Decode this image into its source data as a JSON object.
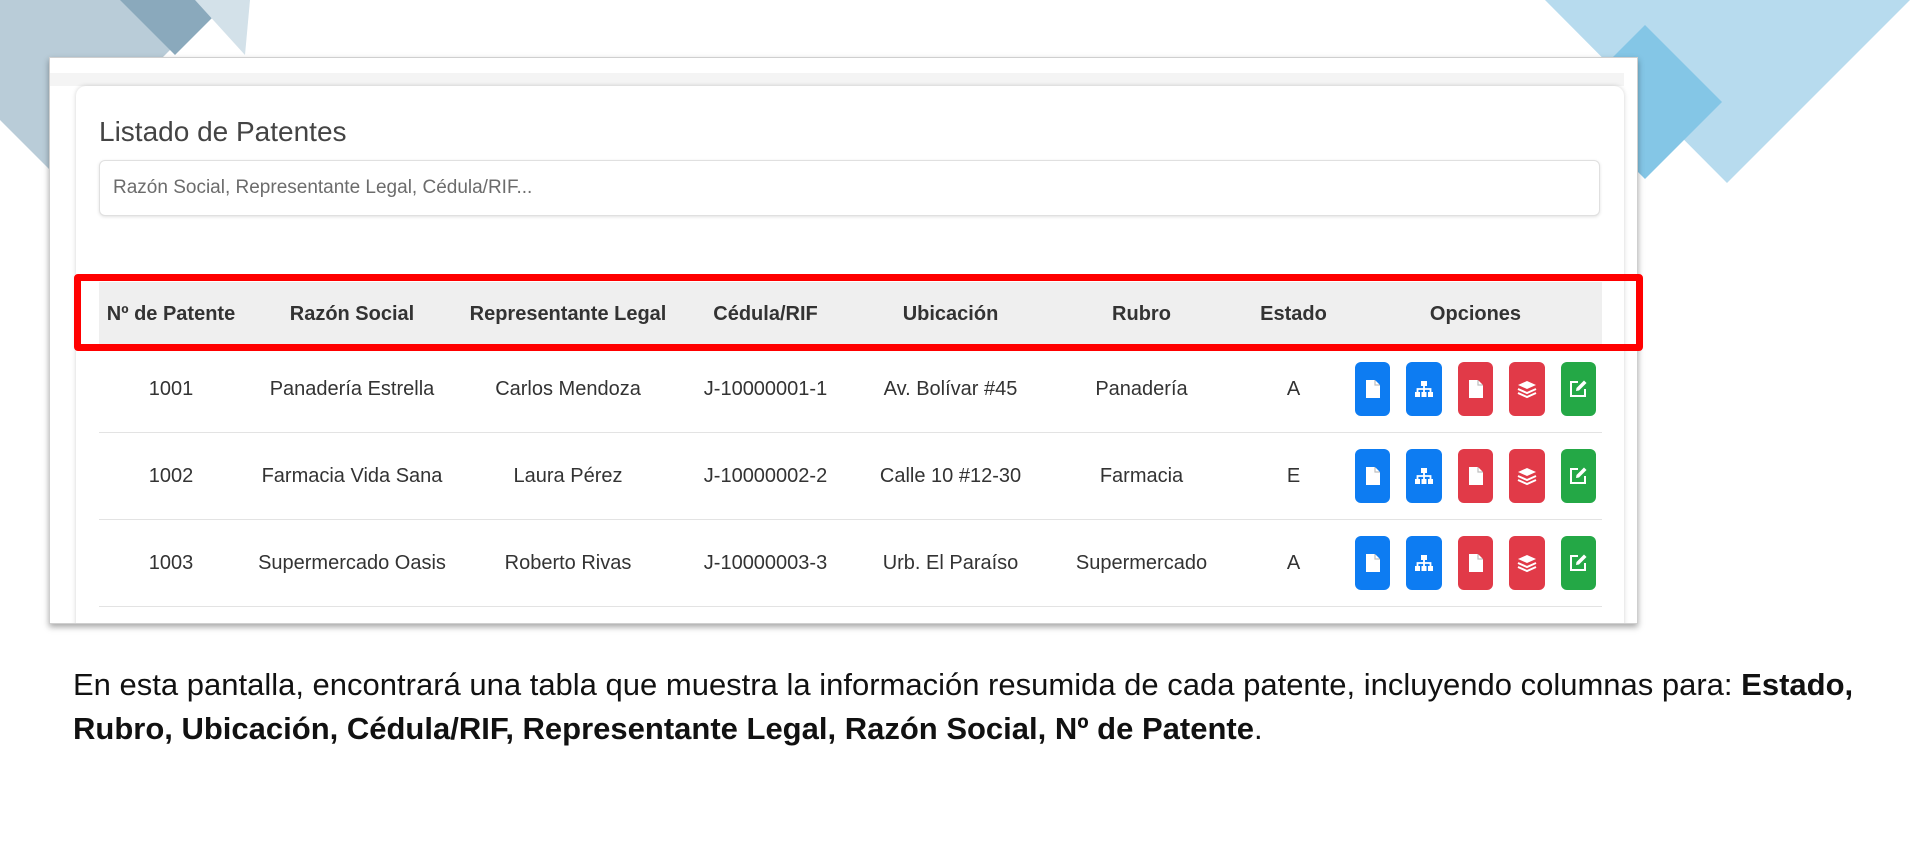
{
  "screen": {
    "title": "Listado de Patentes",
    "search_placeholder": "Razón Social, Representante Legal, Cédula/RIF...",
    "table": {
      "headers": [
        "Nº de Patente",
        "Razón Social",
        "Representante Legal",
        "Cédula/RIF",
        "Ubicación",
        "Rubro",
        "Estado",
        "Opciones"
      ],
      "rows": [
        {
          "patente": "1001",
          "razon_social": "Panadería Estrella",
          "representante": "Carlos Mendoza",
          "cedula_rif": "J-10000001-1",
          "ubicacion": "Av. Bolívar #45",
          "rubro": "Panadería",
          "estado": "A"
        },
        {
          "patente": "1002",
          "razon_social": "Farmacia Vida Sana",
          "representante": "Laura Pérez",
          "cedula_rif": "J-10000002-2",
          "ubicacion": "Calle 10 #12-30",
          "rubro": "Farmacia",
          "estado": "E"
        },
        {
          "patente": "1003",
          "razon_social": "Supermercado Oasis",
          "representante": "Roberto Rivas",
          "cedula_rif": "J-10000003-3",
          "ubicacion": "Urb. El Paraíso",
          "rubro": "Supermercado",
          "estado": "A"
        }
      ]
    },
    "option_buttons": [
      {
        "icon": "file-icon",
        "color": "#0d7cf2"
      },
      {
        "icon": "sitemap-icon",
        "color": "#0d7cf2"
      },
      {
        "icon": "file-icon",
        "color": "#e13a48"
      },
      {
        "icon": "layers-icon",
        "color": "#e13a48"
      },
      {
        "icon": "edit-icon",
        "color": "#24a846"
      }
    ]
  },
  "caption": {
    "text": "En esta pantalla, encontrará una tabla que muestra la información resumida de cada patente, incluyendo columnas para: ",
    "bold": "Estado, Rubro, Ubicación, Cédula/RIF, Representante Legal, Razón Social, Nº de Patente",
    "end": "."
  },
  "colors": {
    "highlight": "#ff0000",
    "button_blue": "#0d7cf2",
    "button_red": "#e13a48",
    "button_green": "#24a846"
  }
}
